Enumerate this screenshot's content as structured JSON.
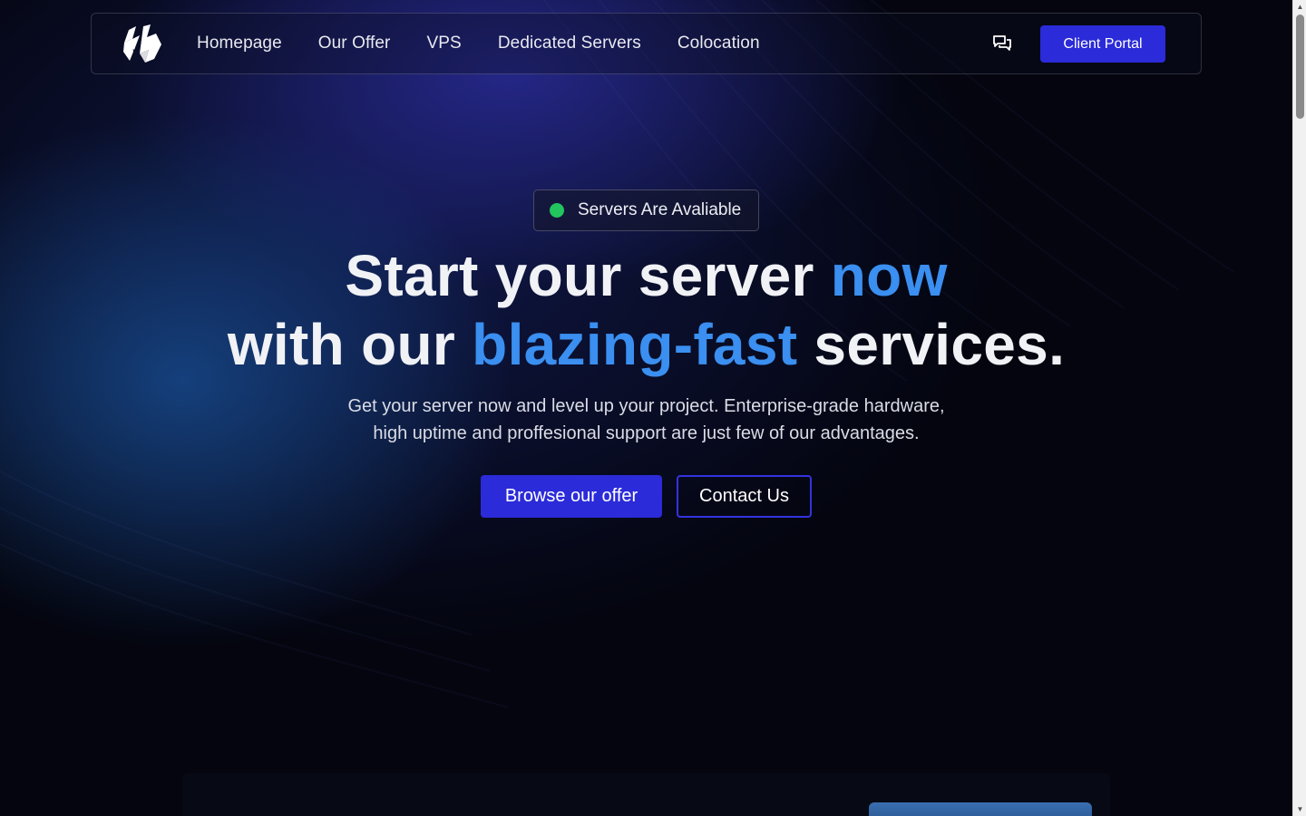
{
  "nav": {
    "links": [
      "Homepage",
      "Our Offer",
      "VPS",
      "Dedicated Servers",
      "Colocation"
    ],
    "chat_icon": "chat-bubbles-icon",
    "client_portal_label": "Client Portal"
  },
  "hero": {
    "status": "Servers Are Avaliable",
    "headline": {
      "line1_part1": "Start your server ",
      "line1_accent": "now",
      "line2_part1": "with our ",
      "line2_accent": "blazing-fast",
      "line2_part2": " services."
    },
    "subtext_line1": "Get your server now and level up your project. Enterprise-grade hardware,",
    "subtext_line2": "high uptime and proffesional support are just few of our advantages.",
    "primary_button": "Browse our offer",
    "secondary_button": "Contact Us"
  },
  "colors": {
    "brand": "#2b2bd9",
    "accent_text": "#3a8ff0",
    "status_dot": "#22c55e",
    "background": "#04050f"
  }
}
